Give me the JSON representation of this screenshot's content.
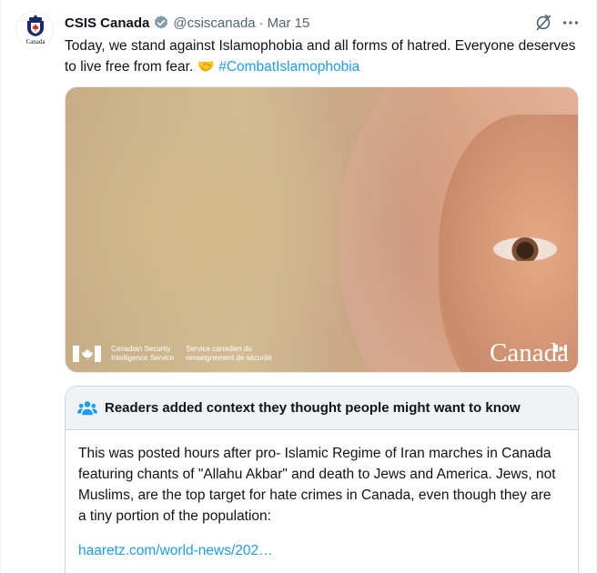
{
  "tweet": {
    "display_name": "CSIS Canada",
    "handle": "@csiscanada",
    "separator": "·",
    "date": "Mar 15",
    "text": "Today, we stand against Islamophobia and all forms of hatred. Everyone deserves to live free from fear. 🤝",
    "hashtag": "#CombatIslamophobia",
    "avatar_word": "Canada",
    "icons": {
      "verified": "verified-badge-icon",
      "grok": "grok-icon",
      "more": "more-options-icon"
    }
  },
  "media": {
    "agency_en_line1": "Canadian Security",
    "agency_en_line2": "Intelligence Service",
    "agency_fr_line1": "Service canadien du",
    "agency_fr_line2": "renseignement de sécurité",
    "wordmark": "Canada"
  },
  "community_note": {
    "title": "Readers added context they thought people might want to know",
    "body": "This was posted hours after pro- Islamic Regime of Iran marches in Canada featuring chants of \"Allahu Akbar\" and death to Jews and America. Jews, not Muslims, are the top target for hate crimes in Canada, even though they are a tiny portion of the population:",
    "link": "haaretz.com/world-news/202…",
    "icon": "people-group-icon"
  },
  "colors": {
    "accent": "#1d9bf0",
    "text": "#0f1419",
    "muted": "#536471",
    "note_header_bg": "#eff3f4",
    "verified_badge": "#829aab",
    "flag_red": "#d52b1e"
  }
}
